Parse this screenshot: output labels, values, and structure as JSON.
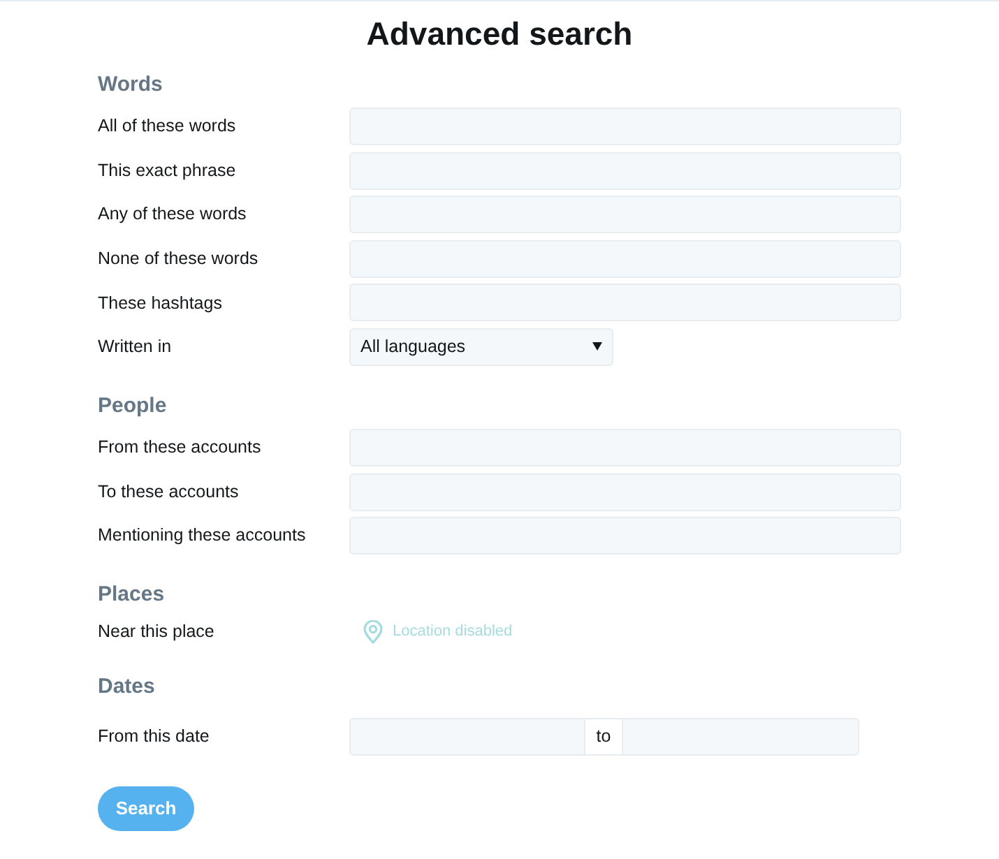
{
  "title": "Advanced search",
  "sections": [
    {
      "heading": "Words",
      "rows": [
        {
          "kind": "text",
          "label": "All of these words"
        },
        {
          "kind": "text",
          "label": "This exact phrase"
        },
        {
          "kind": "text",
          "label": "Any of these words"
        },
        {
          "kind": "text",
          "label": "None of these words"
        },
        {
          "kind": "text",
          "label": "These hashtags"
        },
        {
          "kind": "select",
          "label": "Written in",
          "value": "All languages"
        }
      ]
    },
    {
      "heading": "People",
      "rows": [
        {
          "kind": "text",
          "label": "From these accounts"
        },
        {
          "kind": "text",
          "label": "To these accounts"
        },
        {
          "kind": "text",
          "label": "Mentioning these accounts"
        }
      ]
    },
    {
      "heading": "Places",
      "rows": [
        {
          "kind": "location",
          "label": "Near this place",
          "value": "Location disabled",
          "disabled": true
        }
      ]
    },
    {
      "heading": "Dates",
      "rows": [
        {
          "kind": "daterange",
          "label": "From this date",
          "separator": "to"
        }
      ]
    }
  ],
  "button": "Search"
}
